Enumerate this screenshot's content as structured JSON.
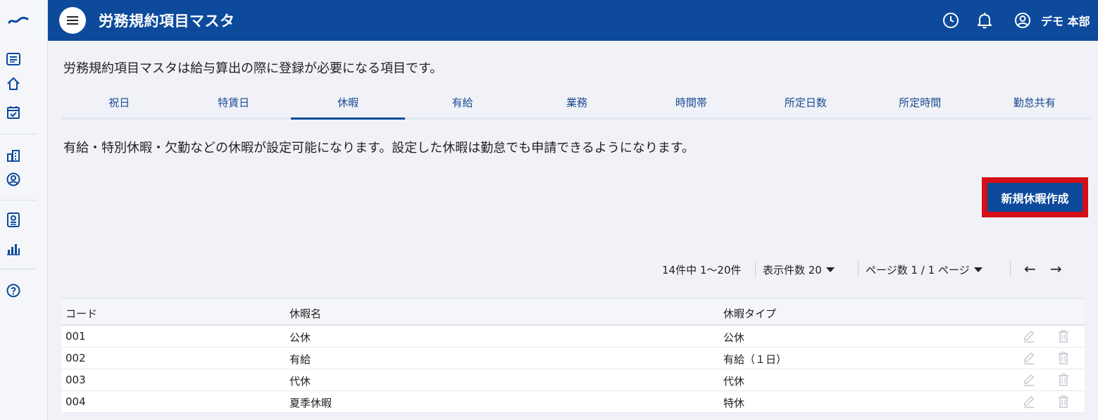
{
  "header": {
    "title": "労務規約項目マスタ",
    "user_name": "デモ 本部"
  },
  "sidebar": {
    "icons": [
      "logo-icon",
      "list-icon",
      "home-icon",
      "calendar-check-icon",
      "building-icon",
      "user-circle-icon",
      "id-badge-icon",
      "bar-chart-icon",
      "help-icon"
    ]
  },
  "main": {
    "description": "労務規約項目マスタは給与算出の際に登録が必要になる項目です。",
    "tabs": [
      {
        "label": "祝日"
      },
      {
        "label": "特賃日"
      },
      {
        "label": "休暇"
      },
      {
        "label": "有給"
      },
      {
        "label": "業務"
      },
      {
        "label": "時間帯"
      },
      {
        "label": "所定日数"
      },
      {
        "label": "所定時間"
      },
      {
        "label": "勤怠共有"
      }
    ],
    "active_tab": "休暇",
    "tab_description": "有給・特別休暇・欠勤などの休暇が設定可能になります。設定した休暇は勤怠でも申請できるようになります。",
    "new_button_label": "新規休暇作成"
  },
  "pagination": {
    "summary": "14件中 1〜20件",
    "per_page_label": "表示件数 20",
    "page_label": "ページ数 1 / 1 ページ",
    "prev": "←",
    "next": "→"
  },
  "table": {
    "columns": [
      "コード",
      "休暇名",
      "休暇タイプ"
    ],
    "rows": [
      {
        "code": "001",
        "name": "公休",
        "type": "公休"
      },
      {
        "code": "002",
        "name": "有給",
        "type": "有給（１日）"
      },
      {
        "code": "003",
        "name": "代休",
        "type": "代休"
      },
      {
        "code": "004",
        "name": "夏季休暇",
        "type": "特休"
      }
    ]
  },
  "colors": {
    "brand": "#0d4a9c",
    "highlight": "#d40f18"
  }
}
